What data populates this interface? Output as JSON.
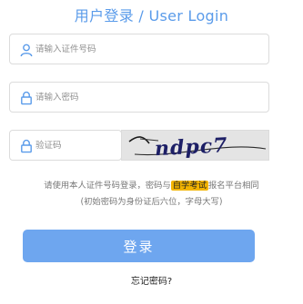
{
  "title": "用户登录 / User Login",
  "colors": {
    "accent": "#5a9bea",
    "button": "#6ea6ef",
    "highlight": "#f3b400"
  },
  "fields": {
    "id_number": {
      "placeholder": "请输入证件号码",
      "value": "",
      "icon": "user-icon"
    },
    "password": {
      "placeholder": "请输入密码",
      "value": "",
      "icon": "lock-icon"
    },
    "captcha": {
      "placeholder": "验证码",
      "value": "",
      "icon": "lock-icon"
    }
  },
  "captcha_image_text": "ndpc7",
  "notice": {
    "prefix": "请使用本人证件号码登录，密码与",
    "highlight": "自学考试",
    "suffix": "报名平台相同",
    "line2": "(初始密码为身份证后六位，字母大写)"
  },
  "login_button": "登录",
  "forgot_link": "忘记密码?"
}
